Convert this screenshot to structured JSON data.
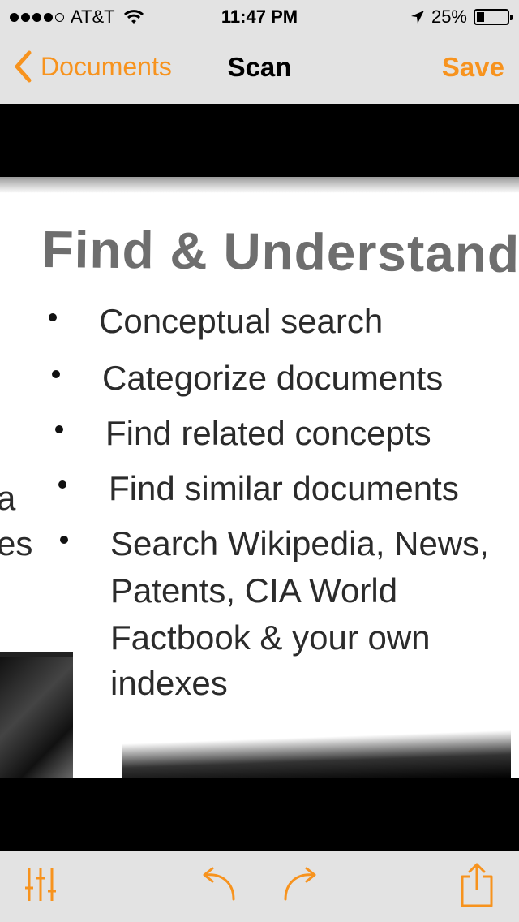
{
  "status_bar": {
    "carrier": "AT&T",
    "time": "11:47 PM",
    "battery_percent": "25%",
    "battery_level": 0.25,
    "signal_bars_filled": 4,
    "signal_bars_total": 5
  },
  "nav": {
    "back_label": "Documents",
    "title": "Scan",
    "save_label": "Save",
    "accent_color": "#f7931e"
  },
  "scan": {
    "heading": "Find & Understand",
    "bullets": [
      "Conceptual search",
      "Categorize documents",
      "Find related concepts",
      "Find similar documents",
      "Search Wikipedia, News,",
      "Patents, CIA World",
      "Factbook  & your own",
      "indexes"
    ],
    "left_fragments": [
      "a",
      "es"
    ]
  },
  "toolbar": {
    "icons": [
      "sliders-icon",
      "undo-icon",
      "redo-icon",
      "share-icon"
    ]
  }
}
